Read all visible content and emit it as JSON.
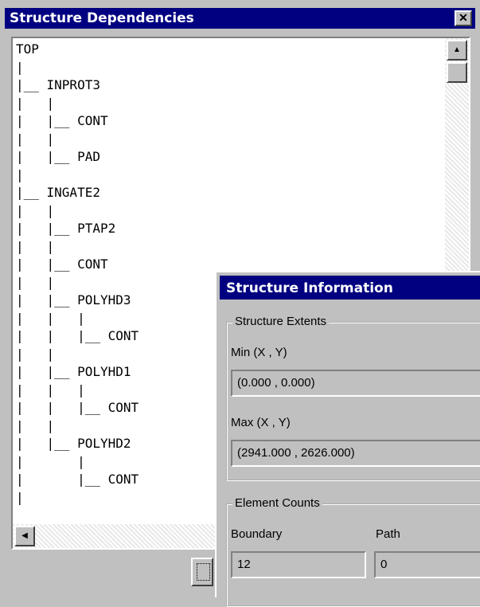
{
  "main": {
    "title": "Structure Dependencies",
    "close_glyph": "✕",
    "tree_lines": [
      "TOP",
      "|",
      "|__ INPROT3",
      "|   |",
      "|   |__ CONT",
      "|   |",
      "|   |__ PAD",
      "|",
      "|__ INGATE2",
      "|   |",
      "|   |__ PTAP2",
      "|   |",
      "|   |__ CONT",
      "|   |",
      "|   |__ POLYHD3",
      "|   |   |",
      "|   |   |__ CONT",
      "|   |",
      "|   |__ POLYHD1",
      "|   |   |",
      "|   |   |__ CONT",
      "|   |",
      "|   |__ POLYHD2",
      "|       |",
      "|       |__ CONT",
      "|"
    ],
    "scroll_up_glyph": "▲",
    "scroll_left_glyph": "◀"
  },
  "info": {
    "title": "Structure Information",
    "extents_legend": "Structure Extents",
    "min_label": "Min (X , Y)",
    "min_value": "(0.000 , 0.000)",
    "max_label": "Max (X , Y)",
    "max_value": "(2941.000 , 2626.000)",
    "counts_legend": "Element Counts",
    "boundary_label": "Boundary",
    "boundary_value": "12",
    "path_label": "Path",
    "path_value": "0"
  }
}
